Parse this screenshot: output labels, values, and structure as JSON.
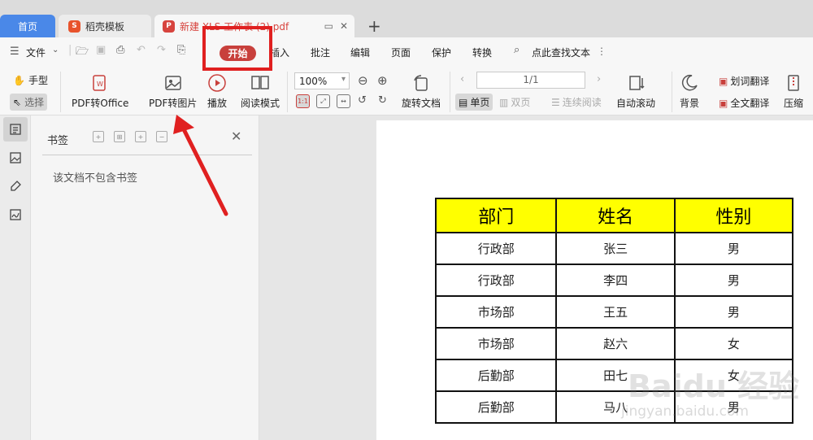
{
  "tabs": {
    "home": "首页",
    "template": "稻壳模板",
    "template_icon": "S",
    "pdf_doc": "新建 XLS 工作表 (2).pdf",
    "pdf_icon": "P",
    "new_tab": "+"
  },
  "menu": {
    "file": "文件",
    "start": "开始",
    "insert": "插入",
    "annotate": "批注",
    "edit": "编辑",
    "page": "页面",
    "protect": "保护",
    "convert": "转换",
    "search": "点此查找文本"
  },
  "ribbon": {
    "hand": "手型",
    "select": "选择",
    "pdf_to_office": "PDF转Office",
    "pdf_to_image": "PDF转图片",
    "play": "播放",
    "read_mode": "阅读模式",
    "zoom": "100%",
    "rotate_doc": "旋转文档",
    "page_display": "1/1",
    "single_page": "单页",
    "double_page": "双页",
    "continuous": "连续阅读",
    "auto_scroll": "自动滚动",
    "background": "背景",
    "word_translate": "划词翻译",
    "full_translate": "全文翻译",
    "compress": "压缩"
  },
  "bookmark_pane": {
    "title": "书签",
    "empty": "该文档不包含书签"
  },
  "document": {
    "headers": [
      "部门",
      "姓名",
      "性别"
    ],
    "rows": [
      [
        "行政部",
        "张三",
        "男"
      ],
      [
        "行政部",
        "李四",
        "男"
      ],
      [
        "市场部",
        "王五",
        "男"
      ],
      [
        "市场部",
        "赵六",
        "女"
      ],
      [
        "后勤部",
        "田七",
        "女"
      ],
      [
        "后勤部",
        "马八",
        "男"
      ]
    ]
  },
  "watermark": {
    "logo": "Baidu 经验",
    "url": "jingyan.baidu.com"
  },
  "colors": {
    "accent_red": "#c8403c",
    "annotation_red": "#e02020",
    "home_tab_blue": "#4a88e8",
    "header_yellow": "#ffff00"
  }
}
